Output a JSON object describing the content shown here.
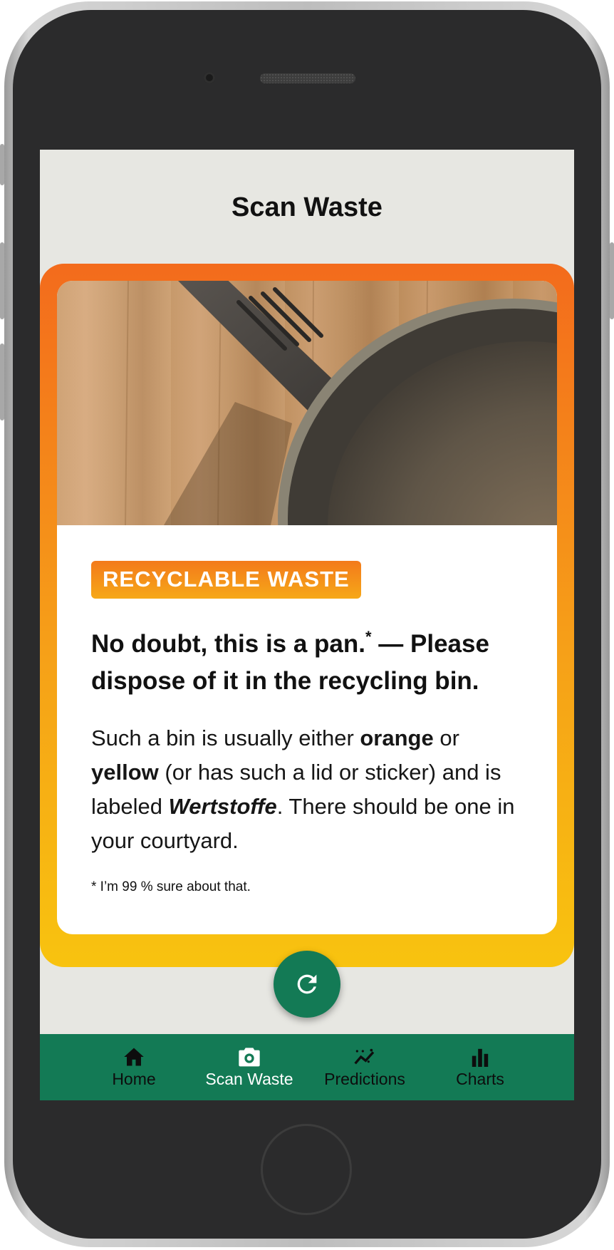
{
  "header": {
    "title": "Scan Waste"
  },
  "result": {
    "badge": "RECYCLABLE WASTE",
    "headline_part1": "No doubt, this is a pan.",
    "headline_marker": "*",
    "headline_part2": " — Please dispose of it in the recycling bin.",
    "desc_1": "Such a bin is usually either ",
    "desc_orange": "orange",
    "desc_2": " or ",
    "desc_yellow": "yellow",
    "desc_3": " (or has such a lid or sticker) and is labeled ",
    "desc_label": "Wertstoffe",
    "desc_4": ". There should be one in your courtyard.",
    "footnote": "* I’m 99 % sure about that.",
    "image_icon": "frying-pan-photo",
    "colors": {
      "gradient_top": "#f36b1c",
      "gradient_bottom": "#f8c30f"
    }
  },
  "refresh": {
    "icon": "refresh-icon",
    "color": "#137a55"
  },
  "nav": {
    "items": [
      {
        "label": "Home",
        "icon": "home-icon"
      },
      {
        "label": "Scan Waste",
        "icon": "camera-icon"
      },
      {
        "label": "Predictions",
        "icon": "trend-icon"
      },
      {
        "label": "Charts",
        "icon": "bar-chart-icon"
      }
    ],
    "active_index": 1,
    "color": "#137a55"
  }
}
